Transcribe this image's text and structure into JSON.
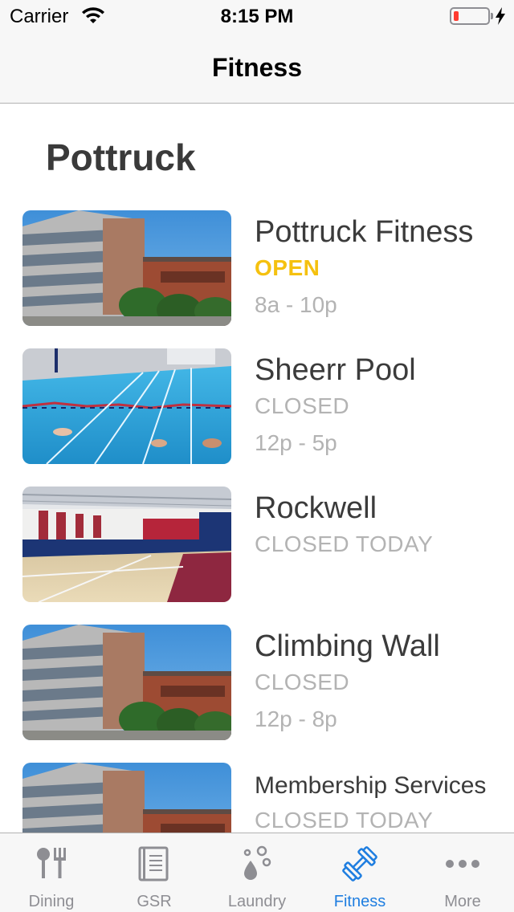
{
  "status_bar": {
    "carrier": "Carrier",
    "time": "8:15 PM",
    "battery_color": "#ff3b30"
  },
  "nav": {
    "title": "Fitness"
  },
  "section": {
    "title": "Pottruck"
  },
  "facilities": [
    {
      "name": "Pottruck Fitness",
      "status": "OPEN",
      "hours": "8a - 10p",
      "image": "building-photo"
    },
    {
      "name": "Sheerr Pool",
      "status": "CLOSED",
      "hours": "12p - 5p",
      "image": "pool-photo"
    },
    {
      "name": "Rockwell",
      "status": "CLOSED TODAY",
      "hours": "",
      "image": "gym-court-photo"
    },
    {
      "name": "Climbing Wall",
      "status": "CLOSED",
      "hours": "12p - 8p",
      "image": "building-photo"
    },
    {
      "name": "Membership Services",
      "status": "CLOSED TODAY",
      "hours": "",
      "image": "building-photo"
    }
  ],
  "colors": {
    "open": "#f5c10f",
    "closed": "#b3b3b3",
    "tab_active": "#1f7ee0",
    "tab_inactive": "#8e8e93"
  },
  "tabs": [
    {
      "label": "Dining",
      "icon": "fork-knife-icon",
      "active": false
    },
    {
      "label": "GSR",
      "icon": "book-icon",
      "active": false
    },
    {
      "label": "Laundry",
      "icon": "bubbles-icon",
      "active": false
    },
    {
      "label": "Fitness",
      "icon": "dumbbell-icon",
      "active": true
    },
    {
      "label": "More",
      "icon": "ellipsis-icon",
      "active": false
    }
  ]
}
